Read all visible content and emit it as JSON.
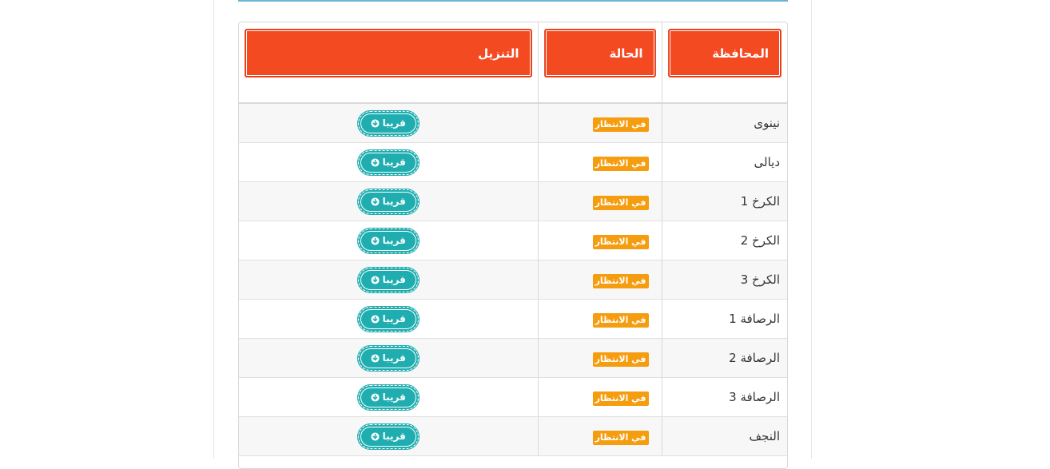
{
  "colors": {
    "header_accent": "#f44a22",
    "badge": "#f59d0f",
    "button": "#1fadb0",
    "top_rule": "#6fb3d2"
  },
  "table": {
    "headers": {
      "governorate": "المحافظة",
      "status": "الحالة",
      "download": "التنزيل"
    },
    "rows": [
      {
        "governorate": "نينوى",
        "status": "في الانتظار",
        "download": "قريبا"
      },
      {
        "governorate": "ديالى",
        "status": "في الانتظار",
        "download": "قريبا"
      },
      {
        "governorate": "الكرخ 1",
        "status": "في الانتظار",
        "download": "قريبا"
      },
      {
        "governorate": "الكرخ 2",
        "status": "في الانتظار",
        "download": "قريبا"
      },
      {
        "governorate": "الكرخ 3",
        "status": "في الانتظار",
        "download": "قريبا"
      },
      {
        "governorate": "الرصافة 1",
        "status": "في الانتظار",
        "download": "قريبا"
      },
      {
        "governorate": "الرصافة 2",
        "status": "في الانتظار",
        "download": "قريبا"
      },
      {
        "governorate": "الرصافة 3",
        "status": "في الانتظار",
        "download": "قريبا"
      },
      {
        "governorate": "النجف",
        "status": "في الانتظار",
        "download": "قريبا"
      }
    ],
    "download_icon": "arrow-circle-down-icon"
  }
}
